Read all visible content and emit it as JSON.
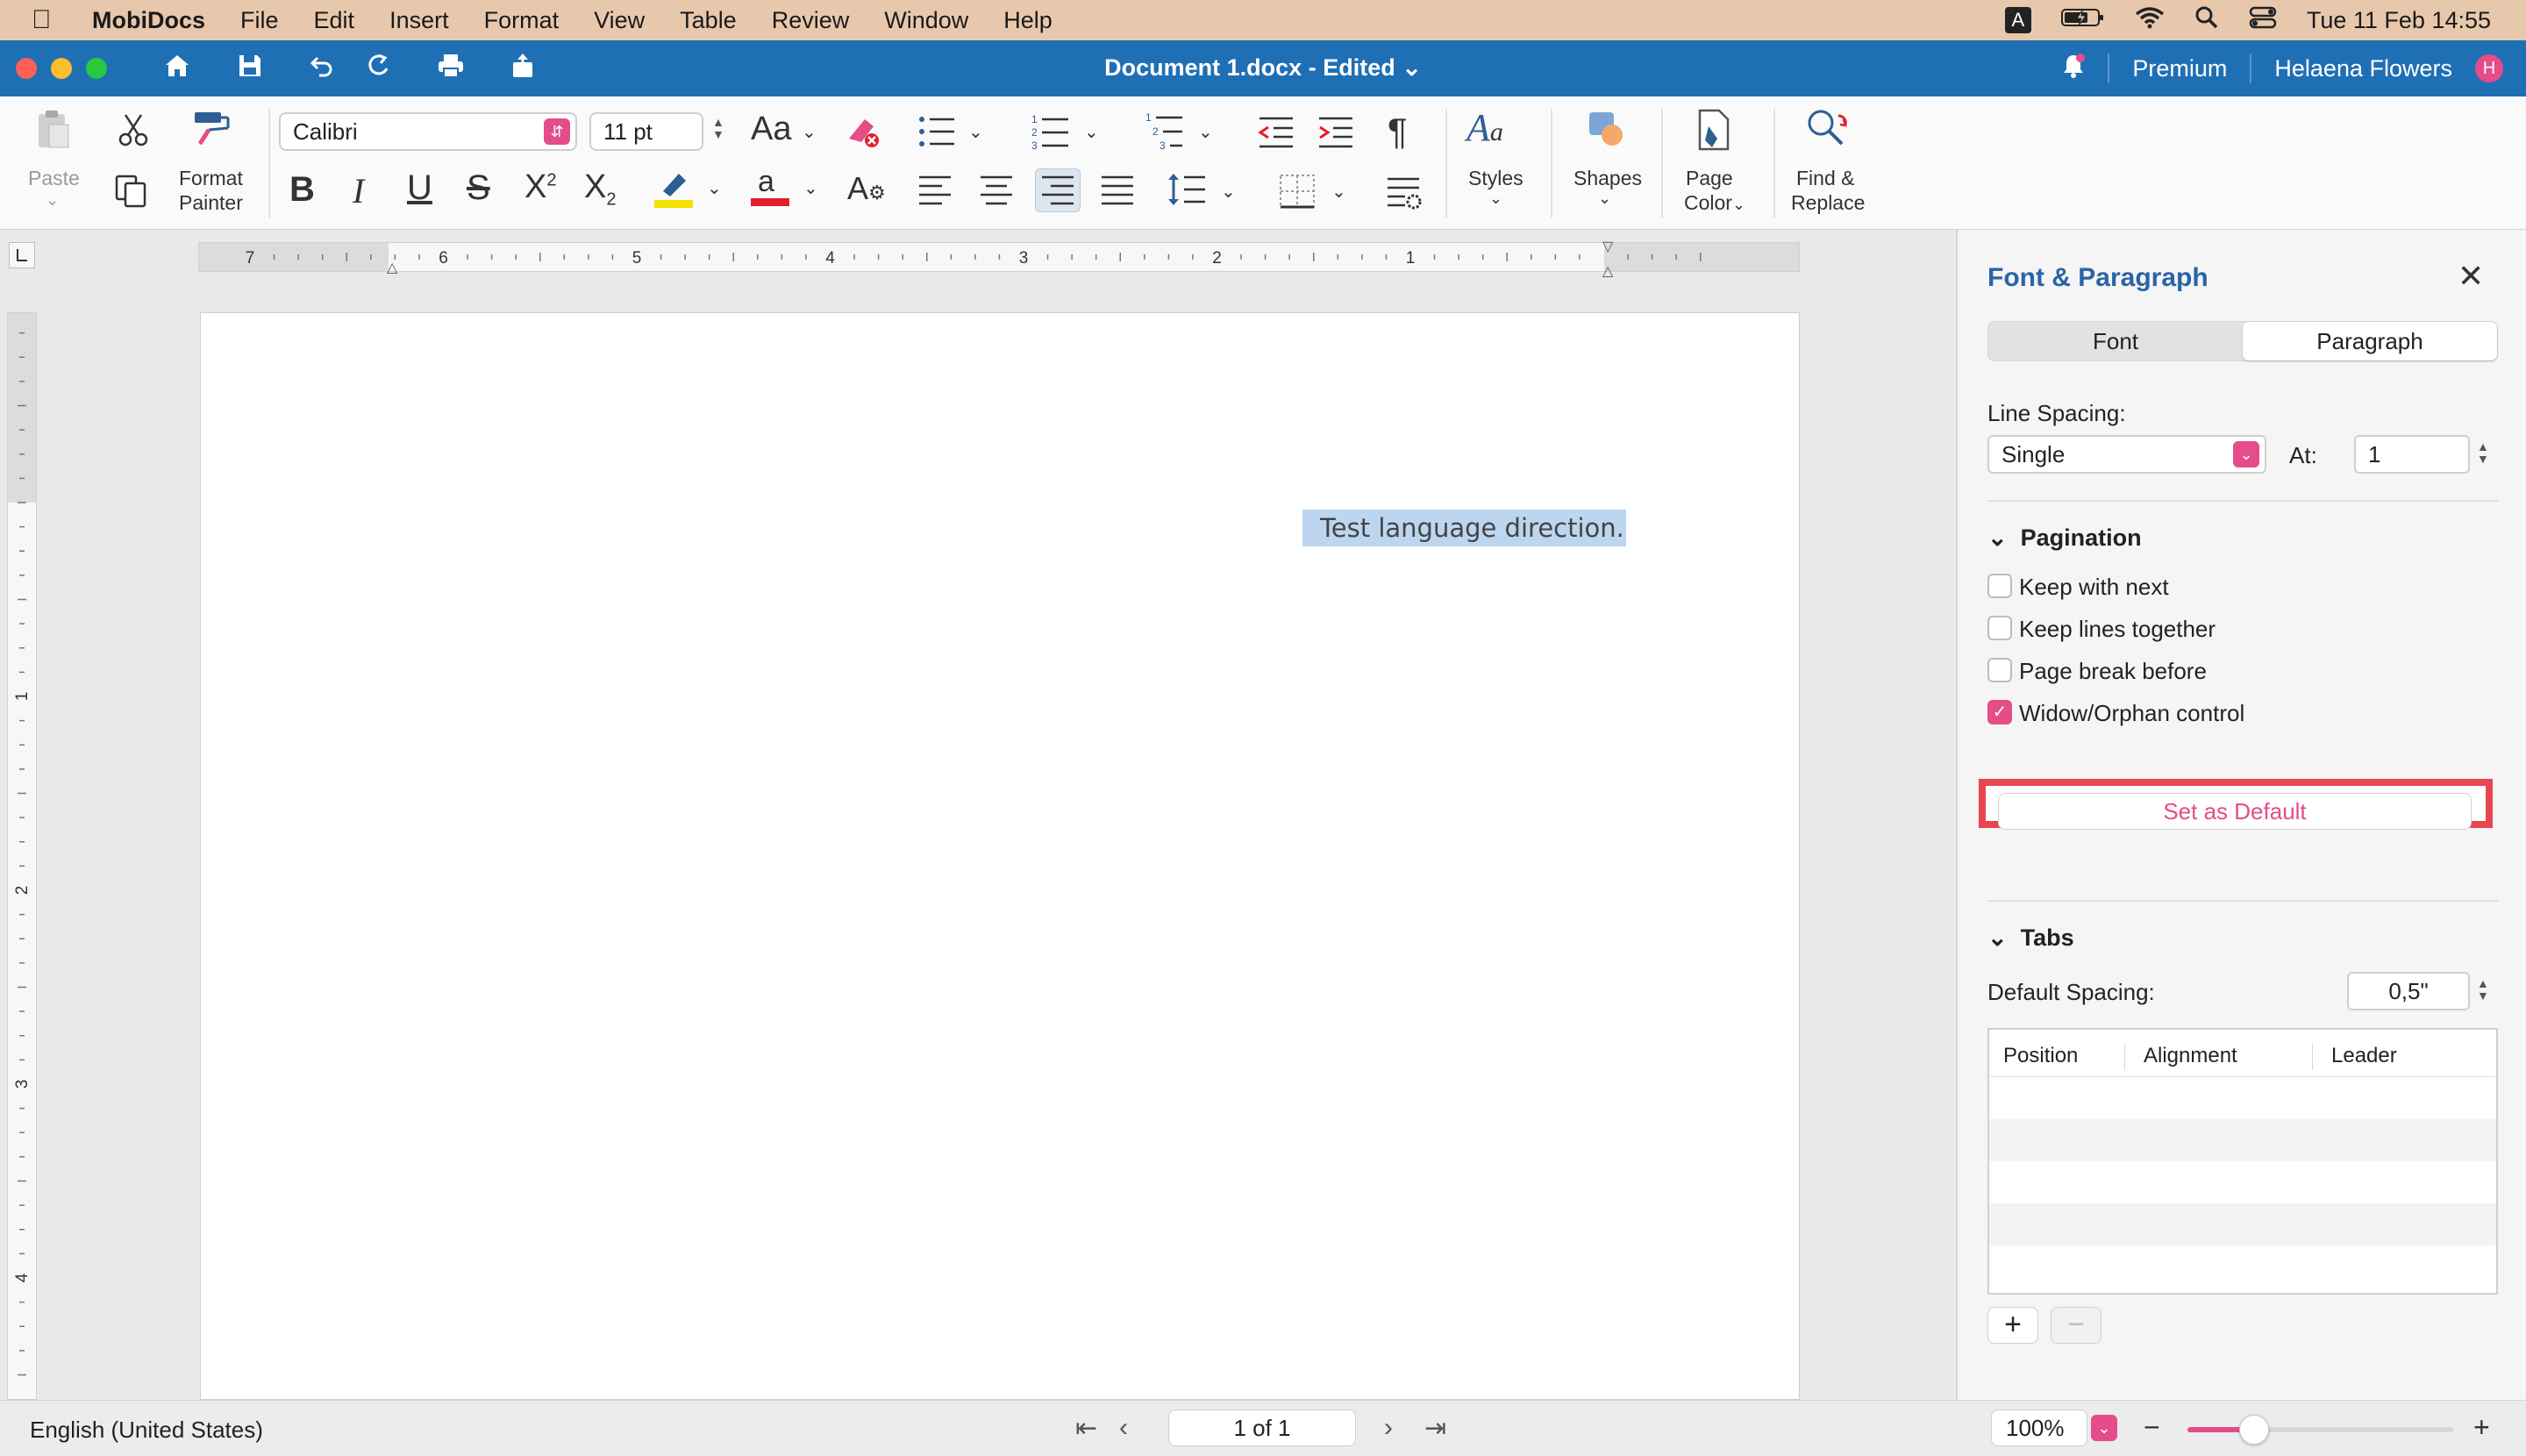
{
  "menubar": {
    "app": "MobiDocs",
    "items": [
      "File",
      "Edit",
      "Insert",
      "Format",
      "View",
      "Table",
      "Review",
      "Window",
      "Help"
    ],
    "input_indicator": "A",
    "clock": "Tue 11 Feb  14:55"
  },
  "titlebar": {
    "title": "Document 1.docx - Edited",
    "premium": "Premium",
    "user": "Helaena Flowers",
    "avatar_letter": "H"
  },
  "ribbon": {
    "paste": "Paste",
    "format_painter_1": "Format",
    "format_painter_2": "Painter",
    "font": "Calibri",
    "font_size": "11 pt",
    "change_case": "Aa",
    "styles": "Styles",
    "shapes": "Shapes",
    "page_color_1": "Page",
    "page_color_2": "Color",
    "find_replace_1": "Find &",
    "find_replace_2": "Replace",
    "highlight_color": "#f5e100",
    "font_color": "#e0202e"
  },
  "ruler": {
    "labels": [
      "7",
      "6",
      "5",
      "4",
      "3",
      "2",
      "1"
    ],
    "vlabels": [
      "1",
      "2",
      "3",
      "4"
    ]
  },
  "document": {
    "selected_text": "Test language direction."
  },
  "panel": {
    "title": "Font & Paragraph",
    "tabs": [
      "Font",
      "Paragraph"
    ],
    "active_tab": "Paragraph",
    "line_spacing_label": "Line Spacing:",
    "line_spacing_value": "Single",
    "at_label": "At:",
    "at_value": "1",
    "pagination_header": "Pagination",
    "checkboxes": [
      {
        "label": "Keep with next",
        "checked": false
      },
      {
        "label": "Keep lines together",
        "checked": false
      },
      {
        "label": "Page break before",
        "checked": false
      },
      {
        "label": "Widow/Orphan control",
        "checked": true
      }
    ],
    "set_default": "Set as Default",
    "tabs_header": "Tabs",
    "default_spacing_label": "Default Spacing:",
    "default_spacing_value": "0,5\"",
    "table_columns": [
      "Position",
      "Alignment",
      "Leader"
    ],
    "add": "+",
    "remove": "−"
  },
  "statusbar": {
    "language": "English (United States)",
    "page_indicator": "1 of 1",
    "zoom": "100%",
    "zoom_fraction": 0.25,
    "accent": "#e44c8a"
  }
}
